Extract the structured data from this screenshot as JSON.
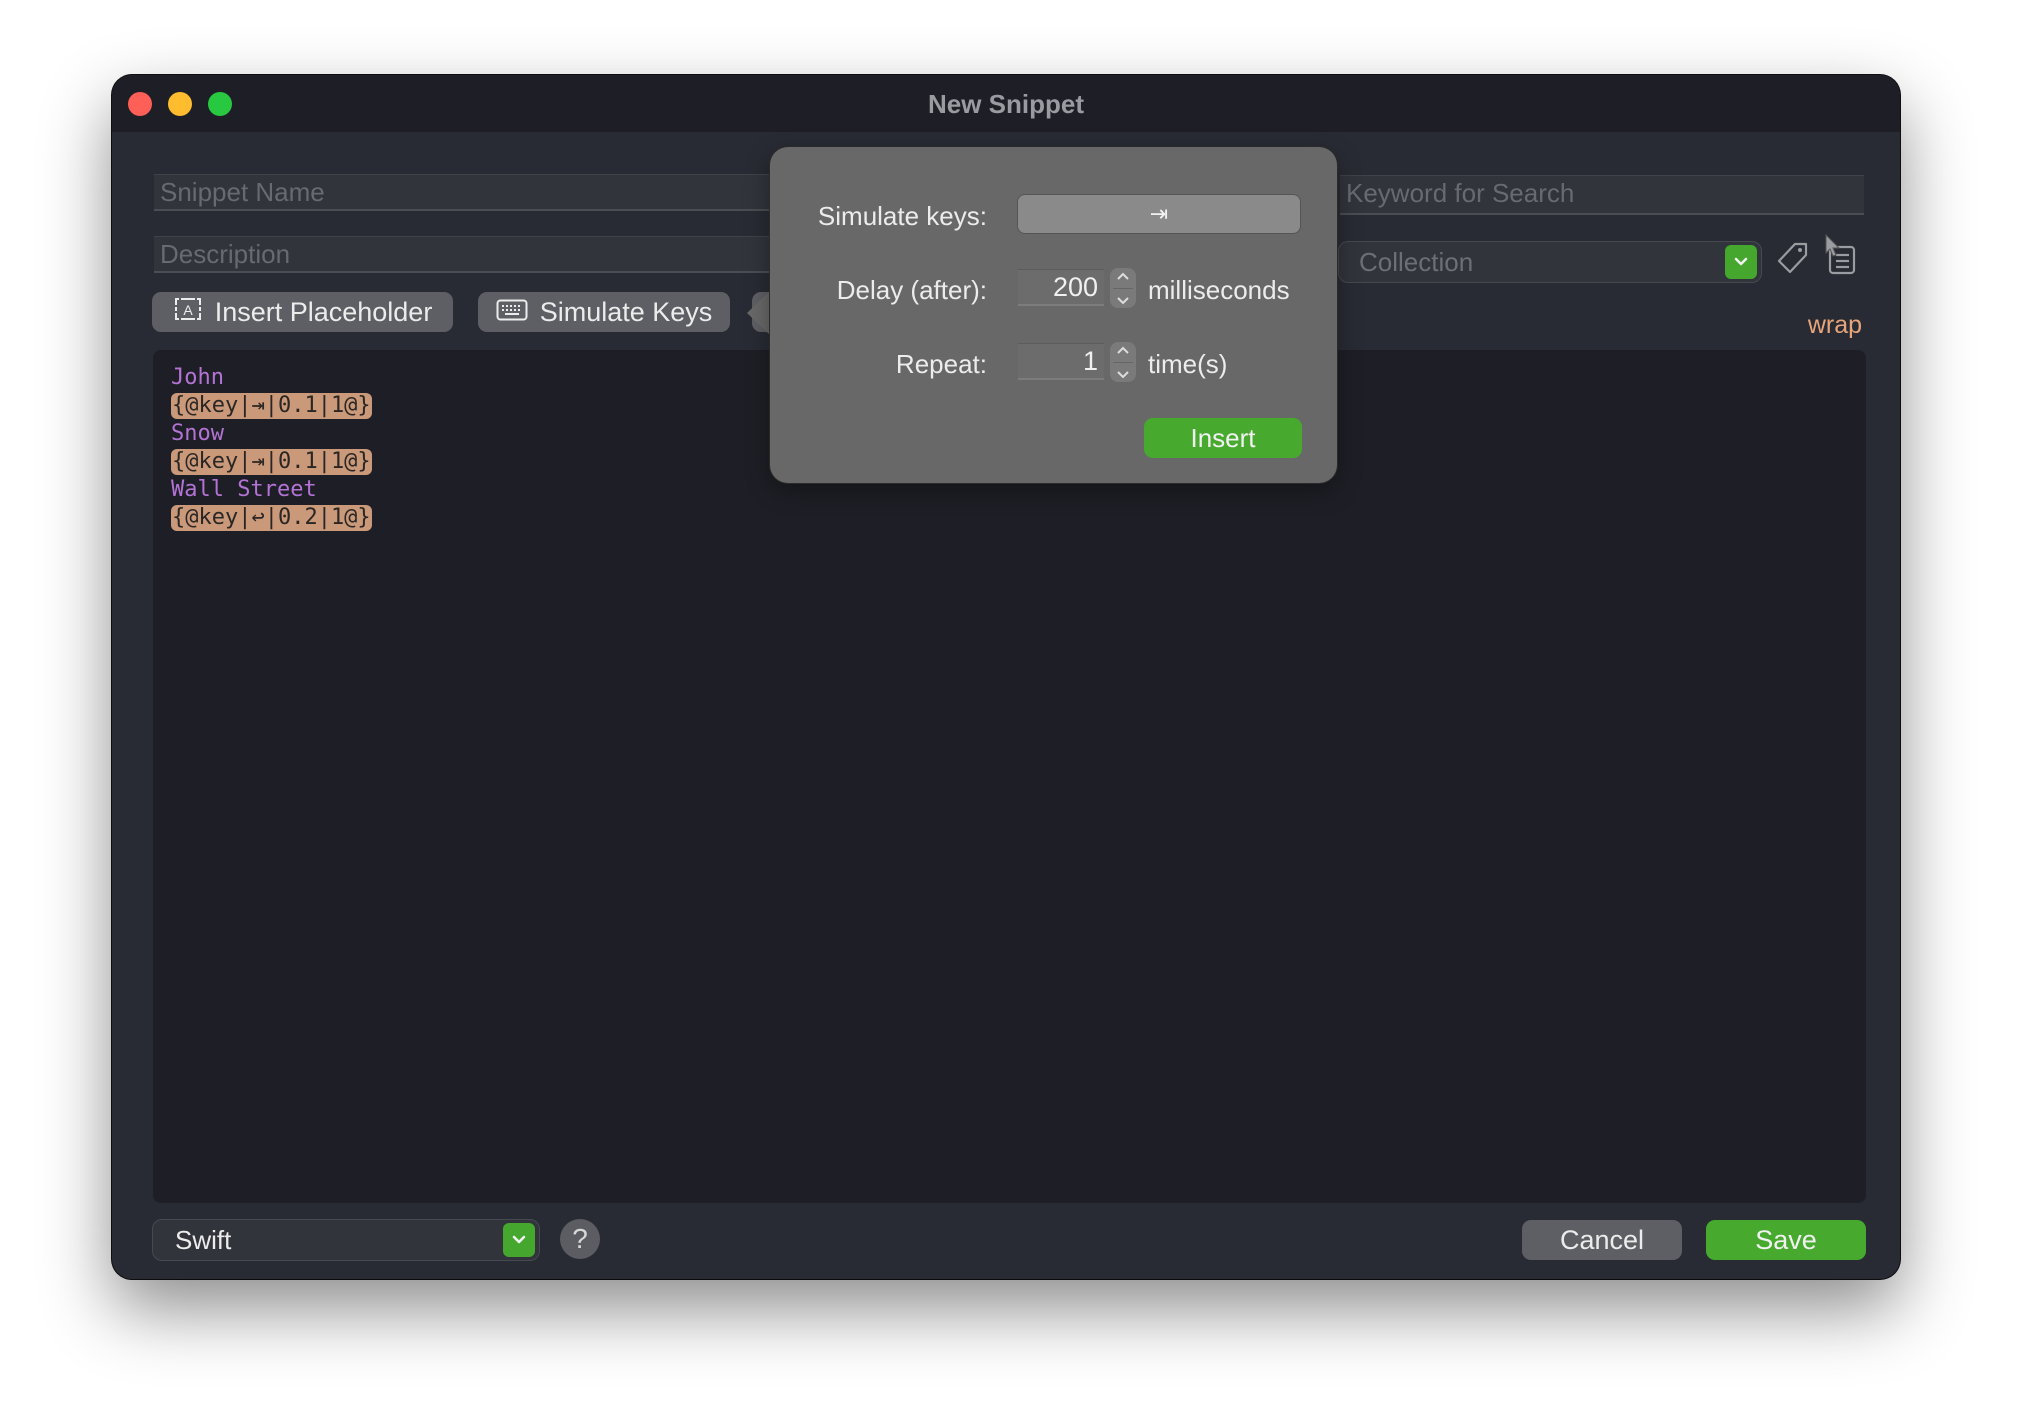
{
  "window": {
    "title": "New Snippet",
    "controls": [
      "close",
      "minimize",
      "zoom"
    ]
  },
  "form": {
    "snippet_name_placeholder": "Snippet Name",
    "description_placeholder": "Description",
    "keyword_placeholder": "Keyword for Search",
    "collection_placeholder": "Collection"
  },
  "toolbar": {
    "insert_placeholder_label": "Insert Placeholder",
    "simulate_keys_label": "Simulate Keys",
    "wrap_label": "wrap",
    "icons": {
      "insert_placeholder": "placeholder-box-icon",
      "simulate_keys": "keyboard-icon",
      "tag": "tag-icon",
      "list": "list-icon"
    }
  },
  "editor": {
    "lines": [
      {
        "type": "text",
        "content": "John"
      },
      {
        "type": "token",
        "content": "{@key|⇥|0.1|1@}"
      },
      {
        "type": "text",
        "content": "Snow"
      },
      {
        "type": "token",
        "content": "{@key|⇥|0.1|1@}"
      },
      {
        "type": "text",
        "content": "Wall Street"
      },
      {
        "type": "token",
        "content": "{@key|↩|0.2|1@}"
      }
    ]
  },
  "popover": {
    "simulate_keys_label": "Simulate keys:",
    "simulate_keys_value": "⇥",
    "delay_label": "Delay (after):",
    "delay_value": "200",
    "delay_unit": "milliseconds",
    "repeat_label": "Repeat:",
    "repeat_value": "1",
    "repeat_unit": "time(s)",
    "insert_label": "Insert"
  },
  "footer": {
    "language_selected": "Swift",
    "help_label": "?",
    "cancel_label": "Cancel",
    "save_label": "Save"
  },
  "colors": {
    "accent_green": "#47aa2f",
    "text_highlight": "#b373d4",
    "token_bg": "#c9997a",
    "wrap_color": "#e8a57b"
  }
}
